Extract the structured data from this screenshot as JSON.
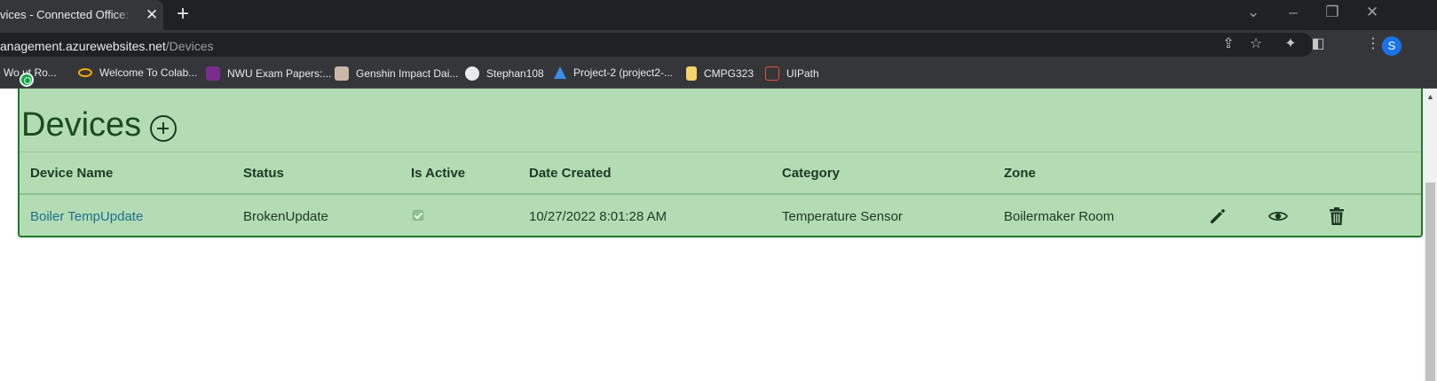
{
  "browser": {
    "tab_title": "vices - Connected Office: Devi",
    "tab_close": "✕",
    "new_tab": "+",
    "url_host": "anagement.azurewebsites.net",
    "url_path": "/Devices",
    "profile_initial": "S",
    "bookmarks": [
      {
        "label": "Wo    ut Ro...",
        "icon": "bookmark-favicon",
        "color": "#8ab4f8"
      },
      {
        "label": "Welcome To Colab...",
        "icon": "colab-icon",
        "color": "#f9ab00"
      },
      {
        "label": "NWU Exam Papers:...",
        "icon": "nwu-icon",
        "color": "#7b2d8e"
      },
      {
        "label": "Genshin Impact Dai...",
        "icon": "genshin-icon",
        "color": "#c9b8a8"
      },
      {
        "label": "Stephan108",
        "icon": "github-icon",
        "color": "#e8eaed"
      },
      {
        "label": "Project-2 (project2-...",
        "icon": "azure-icon",
        "color": "#3b8eea"
      },
      {
        "label": "CMPG323",
        "icon": "folder-icon",
        "color": "#f7d36a"
      },
      {
        "label": "UIPath",
        "icon": "uipath-icon",
        "color": "#e8542f"
      }
    ]
  },
  "page": {
    "title": "Devices",
    "table": {
      "headers": [
        "Device Name",
        "Status",
        "Is Active",
        "Date Created",
        "Category",
        "Zone"
      ],
      "rows": [
        {
          "device_name": "Boiler TempUpdate",
          "status": "BrokenUpdate",
          "is_active": true,
          "date_created": "10/27/2022 8:01:28 AM",
          "category": "Temperature Sensor",
          "zone": "Boilermaker Room"
        }
      ]
    }
  },
  "colors": {
    "panel_bg": "#b3dcb5",
    "panel_border": "#1c7a27",
    "link": "#1f6e8c",
    "text": "#1c3a1f"
  }
}
